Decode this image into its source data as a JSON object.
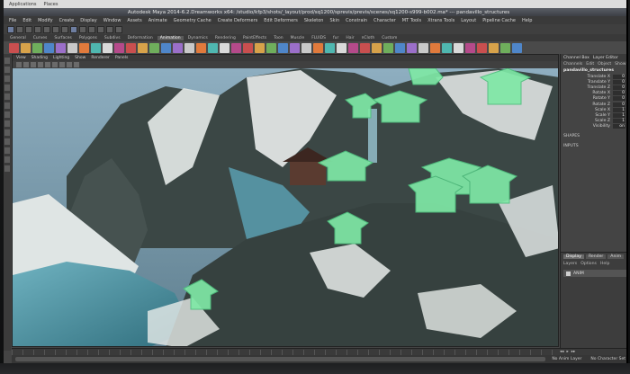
{
  "os_bar": {
    "items": [
      "Applications",
      "Places"
    ]
  },
  "window": {
    "title": "Autodesk Maya 2014-6.2.Dreamworks x64: /studio/kfp3/shots/_layout/prod/sq1200/sprevis/previs/scenes/sq1200-s999-b002.ma* --- pandavillo_structures"
  },
  "menubar": {
    "items": [
      "File",
      "Edit",
      "Modify",
      "Create",
      "Display",
      "Window",
      "Assets",
      "Animate",
      "Geometry Cache",
      "Create Deformers",
      "Edit Deformers",
      "Skeleton",
      "Skin",
      "Constrain",
      "Character",
      "MT Tools",
      "Xtrans Tools",
      "Layout",
      "Pipeline Cache",
      "Help"
    ]
  },
  "shelf_tabs": [
    "General",
    "Curves",
    "Surfaces",
    "Polygons",
    "Subdivs",
    "Deformation",
    "Animation",
    "Dynamics",
    "Rendering",
    "PaintEffects",
    "Toon",
    "Muscle",
    "FLUIDS",
    "fur",
    "Hair",
    "nCloth",
    "Custom"
  ],
  "shelf_active": "Animation",
  "viewport_menu": [
    "View",
    "Shading",
    "Lighting",
    "Show",
    "Renderer",
    "Panels"
  ],
  "channel_box": {
    "tabs": [
      "Channels",
      "Edit",
      "Object",
      "Show"
    ],
    "header": [
      "Channel Box",
      "Layer Editor"
    ],
    "object": "pandavillo_structures",
    "attributes": [
      {
        "label": "Translate X",
        "value": "0"
      },
      {
        "label": "Translate Y",
        "value": "0"
      },
      {
        "label": "Translate Z",
        "value": "0"
      },
      {
        "label": "Rotate X",
        "value": "0"
      },
      {
        "label": "Rotate Y",
        "value": "0"
      },
      {
        "label": "Rotate Z",
        "value": "0"
      },
      {
        "label": "Scale X",
        "value": "1"
      },
      {
        "label": "Scale Y",
        "value": "1"
      },
      {
        "label": "Scale Z",
        "value": "1"
      },
      {
        "label": "Visibility",
        "value": "on"
      }
    ],
    "sections": [
      "SHAPES",
      "INPUTS"
    ]
  },
  "layer_panel": {
    "tabs": [
      "Display",
      "Render",
      "Anim"
    ],
    "menu": [
      "Layers",
      "Options",
      "Help"
    ],
    "layers": [
      {
        "name": "ANIM"
      }
    ]
  },
  "time": {
    "no_anim_layer": "No Anim Layer",
    "no_character_set": "No Character Set"
  },
  "scene_colors": {
    "sky": "#7fa1b5",
    "rock": "#3d4a48",
    "snow": "#e8ecea",
    "water": "#4b8fa0",
    "proxy_green": "#7fe8a6"
  }
}
